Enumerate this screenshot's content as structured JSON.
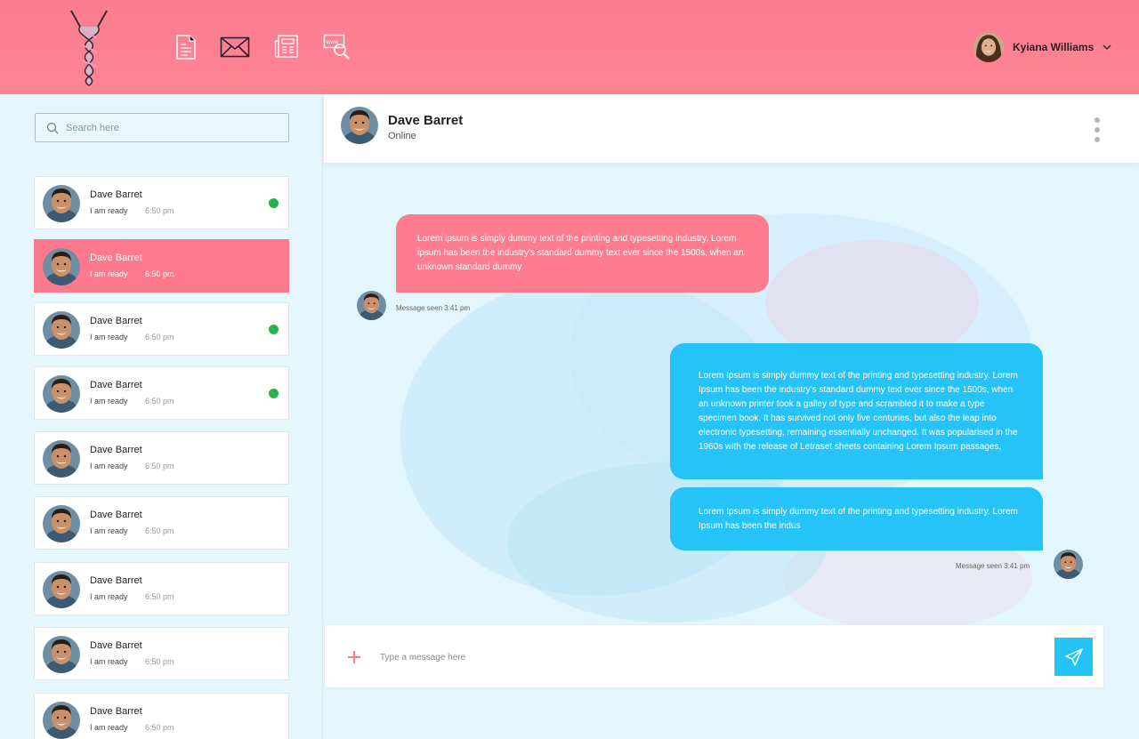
{
  "colors": {
    "header": "#fd7c8e",
    "accent_pink": "#fd7a8c",
    "accent_blue": "#25c3f8",
    "online": "#27b24a",
    "sidebar_bg": "#e5f6fd"
  },
  "header": {
    "nav_icons": [
      "document-icon",
      "mail-icon",
      "newspaper-icon",
      "web-search-icon"
    ],
    "user_name": "Kyiana Williams"
  },
  "sidebar": {
    "search_placeholder": "Search here",
    "contacts": [
      {
        "name": "Dave Barret",
        "message": "I am ready",
        "time": "6:50 pm",
        "online": true,
        "active": false
      },
      {
        "name": "Dave Barret",
        "message": "I am ready",
        "time": "6:50 pm",
        "online": false,
        "active": true
      },
      {
        "name": "Dave Barret",
        "message": "I am ready",
        "time": "6:50 pm",
        "online": true,
        "active": false
      },
      {
        "name": "Dave Barret",
        "message": "I am ready",
        "time": "6:50 pm",
        "online": true,
        "active": false
      },
      {
        "name": "Dave Barret",
        "message": "I am ready",
        "time": "6:50 pm",
        "online": false,
        "active": false
      },
      {
        "name": "Dave Barret",
        "message": "I am ready",
        "time": "6:50 pm",
        "online": false,
        "active": false
      },
      {
        "name": "Dave Barret",
        "message": "I am ready",
        "time": "6:50 pm",
        "online": false,
        "active": false
      },
      {
        "name": "Dave Barret",
        "message": "I am ready",
        "time": "6:50 pm",
        "online": false,
        "active": false
      },
      {
        "name": "Dave Barret",
        "message": "I am ready",
        "time": "6:50 pm",
        "online": false,
        "active": false
      }
    ]
  },
  "chat": {
    "contact_name": "Dave Barret",
    "status": "Online",
    "messages": [
      {
        "direction": "in",
        "text": "Lorem ipsum is simply dummy text of the printing and typesetting industry. Lorem ipsum has been the industry's standard dummy text ever since the 1500s, when an unknown  standard dummy",
        "seen": "Message seen 3:41 pm"
      },
      {
        "direction": "out",
        "text": "Lorem Ipsum is simply dummy text of the printing and typesetting industry. Lorem Ipsum has been the industry's standard dummy text ever since the 1500s, when an unknown printer took a galley of type and scrambled it to make a type specimen book. It has survived not only five centuries, but also the leap into electronic typesetting, remaining essentially unchanged. It was popularised in the 1960s with the release of Letraset sheets containing Lorem Ipsum passages,"
      },
      {
        "direction": "out",
        "text": "Lorem Ipsum is simply dummy text of the printing and typesetting industry. Lorem Ipsum has been the indus",
        "seen": "Message seen 3:41 pm"
      }
    ],
    "composer_placeholder": "Type a message here"
  }
}
